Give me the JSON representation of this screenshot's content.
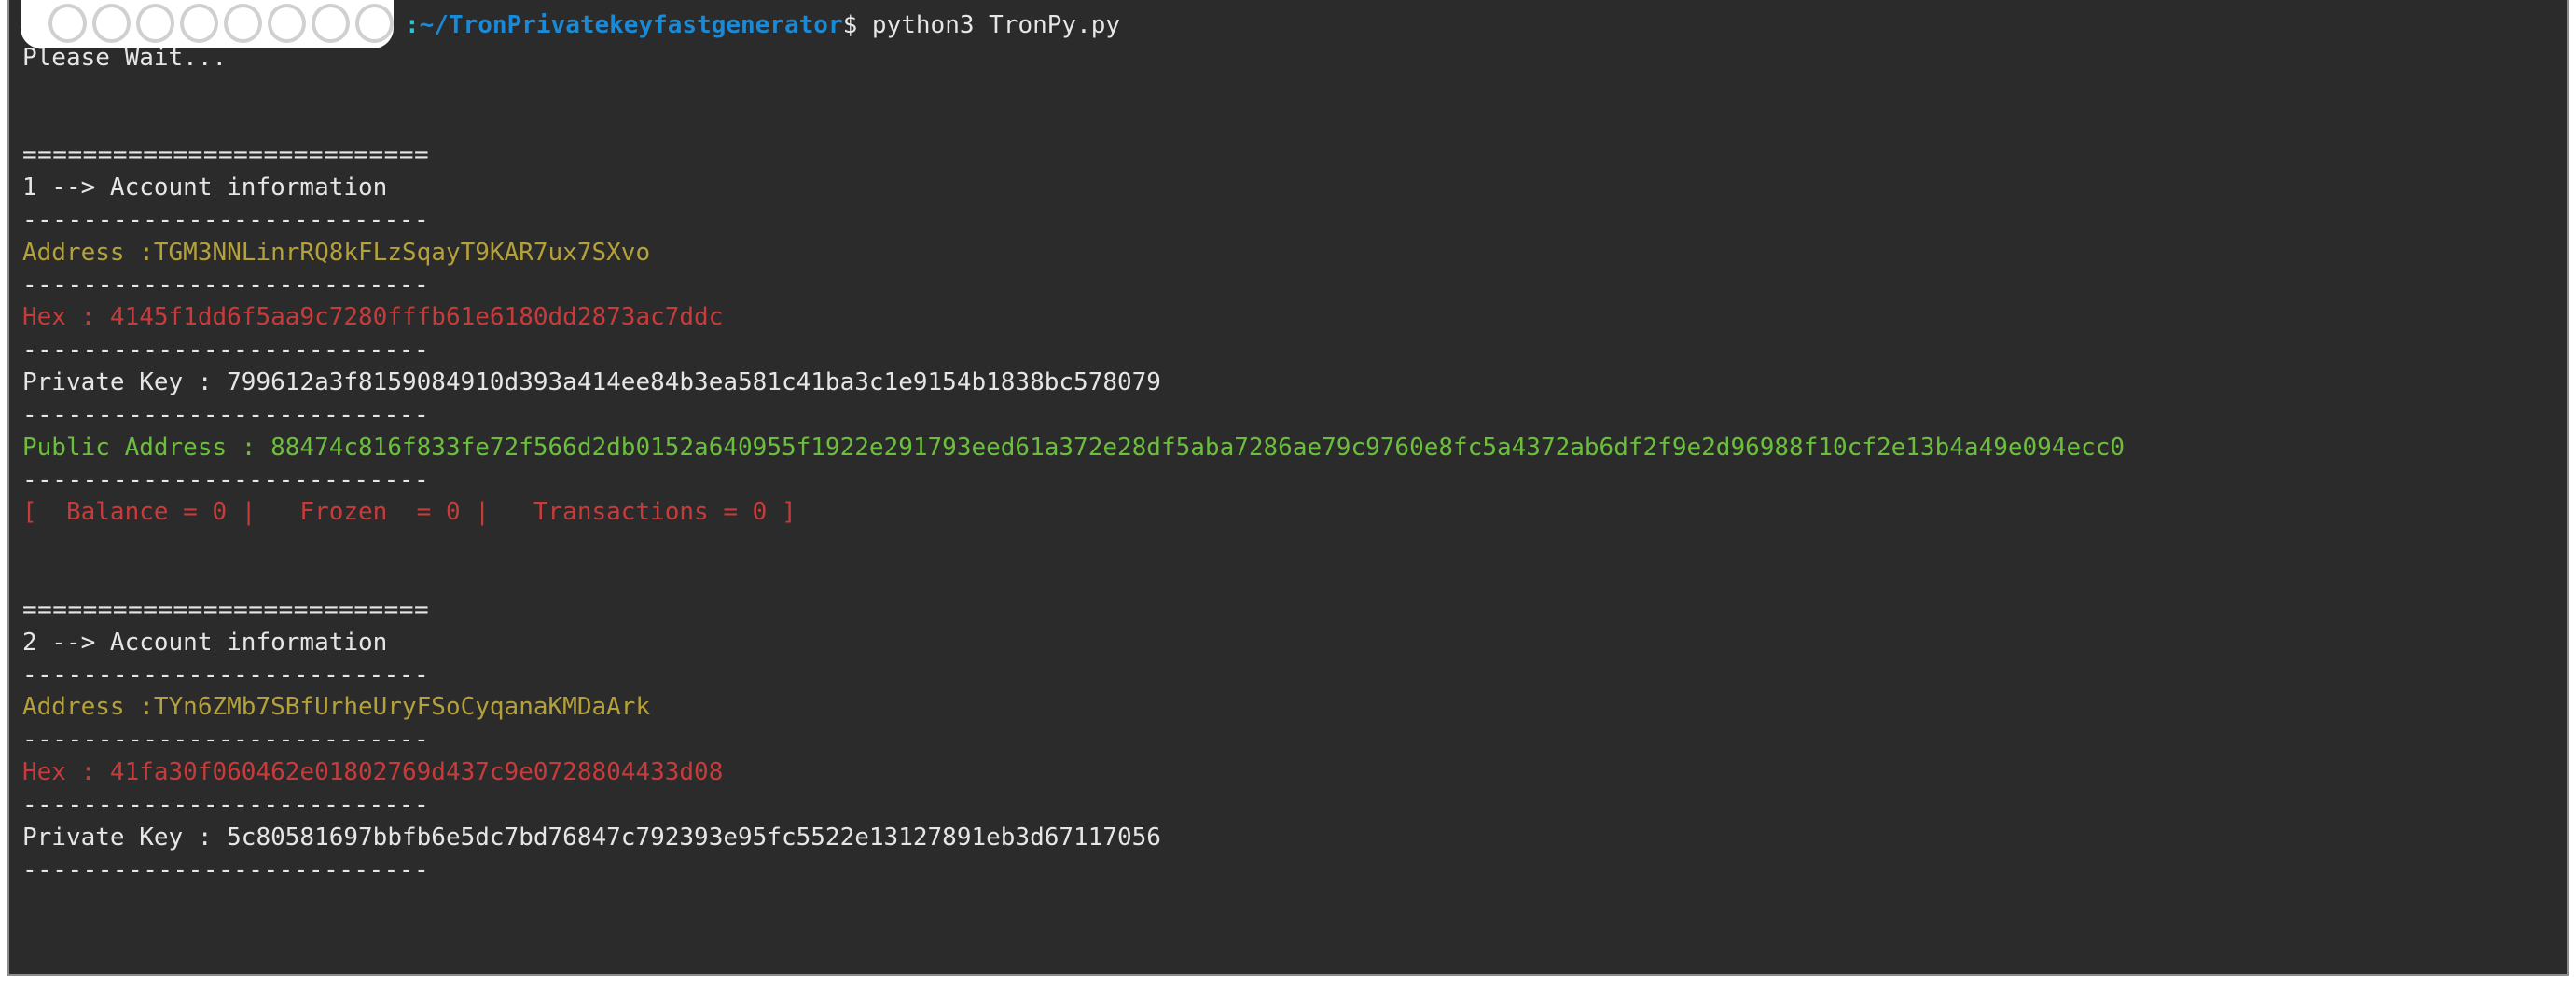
{
  "prompt": {
    "sep": ":",
    "cwd": "~/TronPrivatekeyfastgenerator",
    "dollar": "$",
    "command": "python3 TronPy.py"
  },
  "wait_line": "Please Wait...",
  "div_eq": "===========================",
  "div_dash": "---------------------------",
  "accounts": [
    {
      "header": "1 --> Account information",
      "address_line": "Address :TGM3NNLinrRQ8kFLzSqayT9KAR7ux7SXvo",
      "hex_line": "Hex : 4145f1dd6f5aa9c7280fffb61e6180dd2873ac7ddc",
      "privkey_line": "Private Key : 799612a3f8159084910d393a414ee84b3ea581c41ba3c1e9154b1838bc578079",
      "pubaddr_line": "Public Address : 88474c816f833fe72f566d2db0152a640955f1922e291793eed61a372e28df5aba7286ae79c9760e8fc5a4372ab6df2f9e2d96988f10cf2e13b4a49e094ecc0",
      "stats_line": "[  Balance = 0 |   Frozen  = 0 |   Transactions = 0 ]"
    },
    {
      "header": "2 --> Account information",
      "address_line": "Address :TYn6ZMb7SBfUrheUryFSoCyqanaKMDaArk",
      "hex_line": "Hex : 41fa30f060462e01802769d437c9e0728804433d08",
      "privkey_line": "Private Key : 5c80581697bbfb6e5dc7bd76847c792393e95fc5522e13127891eb3d67117056"
    }
  ]
}
